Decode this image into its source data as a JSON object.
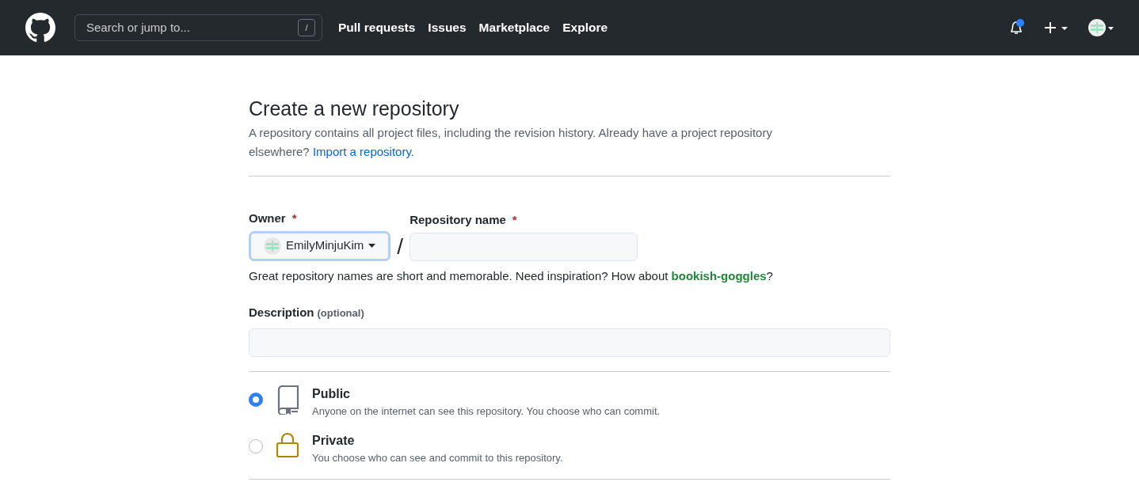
{
  "header": {
    "search": {
      "placeholder": "Search or jump to...",
      "shortcut": "/"
    },
    "nav": [
      "Pull requests",
      "Issues",
      "Marketplace",
      "Explore"
    ],
    "notifications": {
      "unread": true
    }
  },
  "page": {
    "title": "Create a new repository",
    "intro": "A repository contains all project files, including the revision history. Already have a project repository elsewhere?",
    "import_link": "Import a repository."
  },
  "owner": {
    "label": "Owner",
    "required_mark": "*",
    "value": "EmilyMinjuKim",
    "focused": true
  },
  "separator": "/",
  "repo_name": {
    "label": "Repository name",
    "required_mark": "*"
  },
  "name_hint": {
    "before": "Great repository names are short and memorable. Need inspiration? How about",
    "suggestion": "bookish-goggles",
    "after": "?"
  },
  "description": {
    "label": "Description",
    "note": "(optional)"
  },
  "visibility": [
    {
      "kind": "public",
      "title": "Public",
      "text": "Anyone on the internet can see this repository. You choose who can commit.",
      "selected": true
    },
    {
      "kind": "private",
      "title": "Private",
      "text": "You choose who can see and commit to this repository.",
      "selected": false
    }
  ]
}
